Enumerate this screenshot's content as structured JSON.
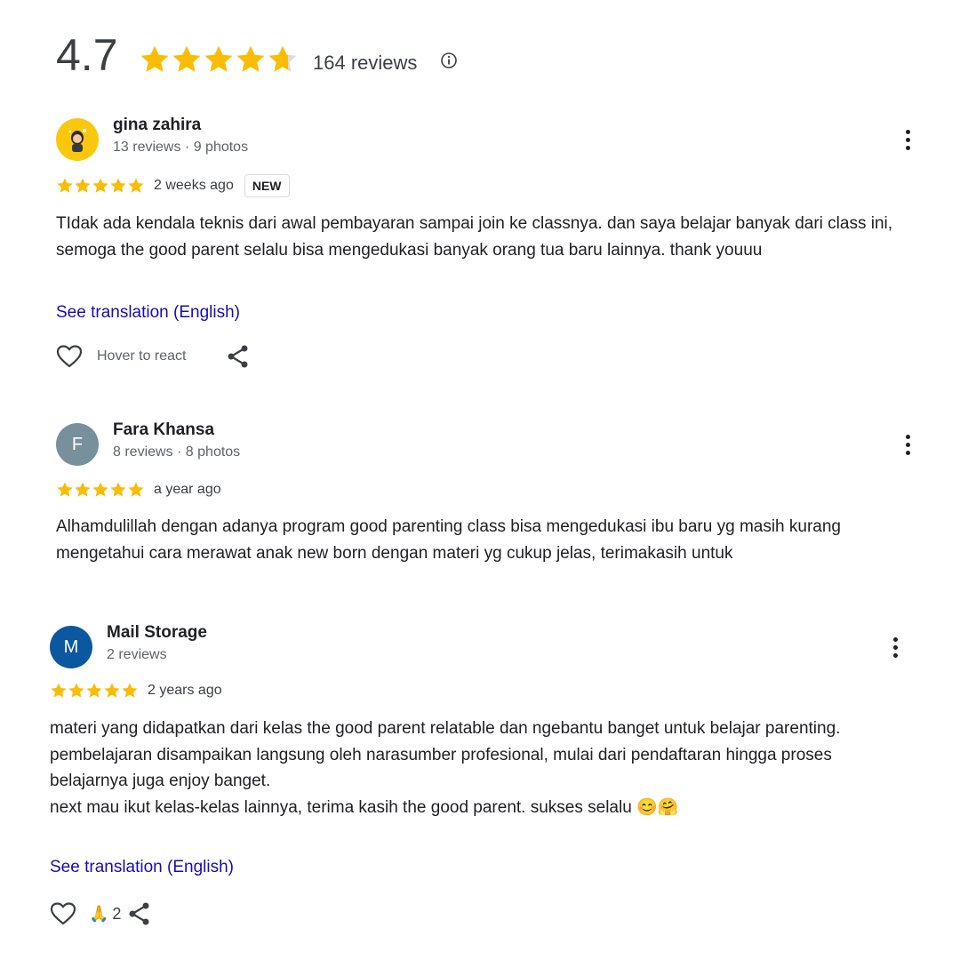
{
  "summary": {
    "average": "4.7",
    "rating_value": 4.7,
    "total": "164 reviews",
    "star_color": "#fbbc04",
    "info_icon": "info-icon"
  },
  "reviews": [
    {
      "name": "gina zahira",
      "meta": "13 reviews · 9 photos",
      "rating": 5,
      "when": "2 weeks ago",
      "badge": "NEW",
      "text": [
        "TIdak ada kendala teknis dari awal pembayaran sampai join ke classnya. dan saya belajar banyak dari class ini, semoga the good parent selalu bisa mengedukasi banyak orang tua baru lainnya. thank youuu"
      ],
      "translate": "See translation (English)",
      "react_label": "Hover to react"
    },
    {
      "name": "Fara Khansa",
      "avatar_letter": "F",
      "avatar_color": "#78909c",
      "meta": "8 reviews · 8 photos",
      "rating": 5,
      "when": "a year ago",
      "text": [
        "Alhamdulillah dengan adanya program good parenting class bisa mengedukasi ibu baru yg masih kurang mengetahui cara merawat anak new born dengan materi yg cukup jelas, terimakasih untuk"
      ]
    },
    {
      "name": "Mail Storage",
      "avatar_letter": "M",
      "avatar_color": "#0b57a0",
      "meta": "2 reviews",
      "rating": 5,
      "when": "2 years ago",
      "text": [
        "materi yang didapatkan dari kelas the good parent relatable dan ngebantu banget untuk belajar parenting.",
        "pembelajaran disampaikan langsung oleh narasumber profesional, mulai dari pendaftaran hingga proses belajarnya juga enjoy banget.",
        "next mau ikut kelas-kelas lainnya, terima kasih the good parent. sukses selalu 😊🤗"
      ],
      "translate": "See translation (English)",
      "reaction_emoji": "🙏",
      "reaction_count": "2"
    }
  ]
}
